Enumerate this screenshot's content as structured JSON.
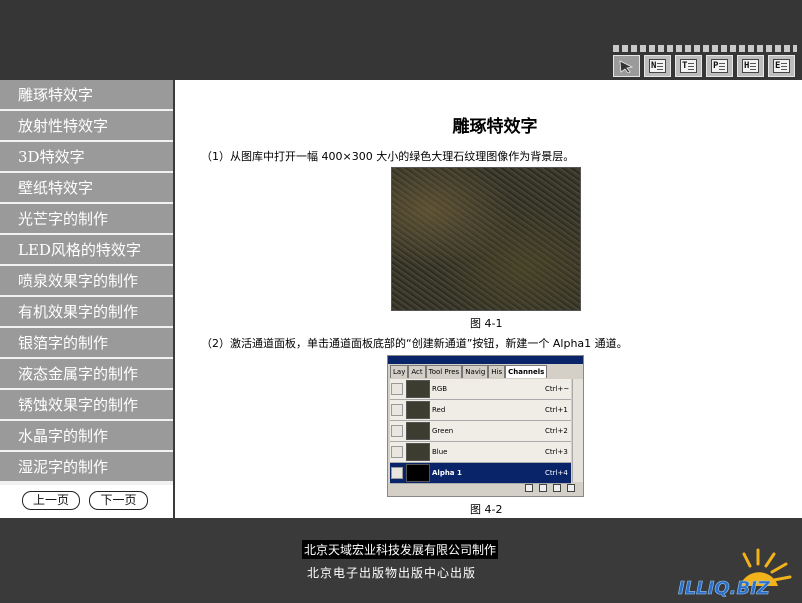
{
  "nav": {
    "items": [
      "雕琢特效字",
      "放射性特效字",
      "3D特效字",
      "壁纸特效字",
      "光芒字的制作",
      "LED风格的特效字",
      "喷泉效果字的制作",
      "有机效果字的制作",
      "银箔字的制作",
      "液态金属字的制作",
      "锈蚀效果字的制作",
      "水晶字的制作",
      "湿泥字的制作"
    ],
    "prev_label": "上一页",
    "next_label": "下一页"
  },
  "toolbar": {
    "icons": [
      "cursor-icon",
      "N",
      "T",
      "P",
      "H",
      "E"
    ]
  },
  "main": {
    "title": "雕琢特效字",
    "step1": "（1）从图库中打开一幅 400×300 大小的绿色大理石纹理图像作为背景层。",
    "fig1": "图 4-1",
    "step2": "（2）激活通道面板，单击通道面板底部的“创建新通道”按钮，新建一个 Alpha1 通道。",
    "fig2": "图 4-2"
  },
  "channels_panel": {
    "tabs": [
      "Lay",
      "Act",
      "Tool Pres",
      "Navig",
      "His",
      "Channels"
    ],
    "rows": [
      {
        "name": "RGB",
        "shortcut": "Ctrl+~"
      },
      {
        "name": "Red",
        "shortcut": "Ctrl+1"
      },
      {
        "name": "Green",
        "shortcut": "Ctrl+2"
      },
      {
        "name": "Blue",
        "shortcut": "Ctrl+3"
      },
      {
        "name": "Alpha 1",
        "shortcut": "Ctrl+4"
      }
    ]
  },
  "footer": {
    "line1": "北京天域宏业科技发展有限公司制作",
    "line2": "北京电子出版物出版中心出版",
    "logo_text": "ILLIQ.BIZ"
  }
}
